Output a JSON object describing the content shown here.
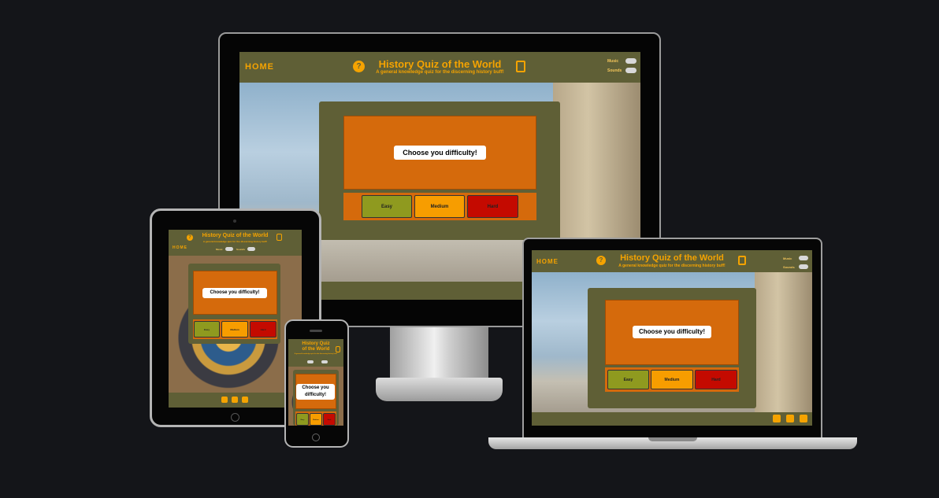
{
  "app": {
    "title": "History Quiz of the World",
    "title_line1": "History Quiz",
    "title_line2": "of the World",
    "subtitle": "A general knowledge quiz for the discerning history buff!",
    "home": "HOME",
    "music_label": "Music",
    "sounds_label": "Sounds",
    "prompt": "Choose you difficulty!",
    "prompt_line1": "Choose you",
    "prompt_line2": "difficulty!",
    "difficulty": {
      "easy": "Easy",
      "medium": "Medium",
      "hard": "Hard"
    }
  },
  "colors": {
    "header": "#5f5f36",
    "accent": "#f5a300",
    "question_box": "#d56a0c",
    "easy": "#8f9a1f",
    "medium": "#f79d00",
    "hard": "#c40a00"
  },
  "icons": [
    "help-icon",
    "book-icon",
    "facebook-icon",
    "instagram-icon",
    "twitter-icon"
  ]
}
